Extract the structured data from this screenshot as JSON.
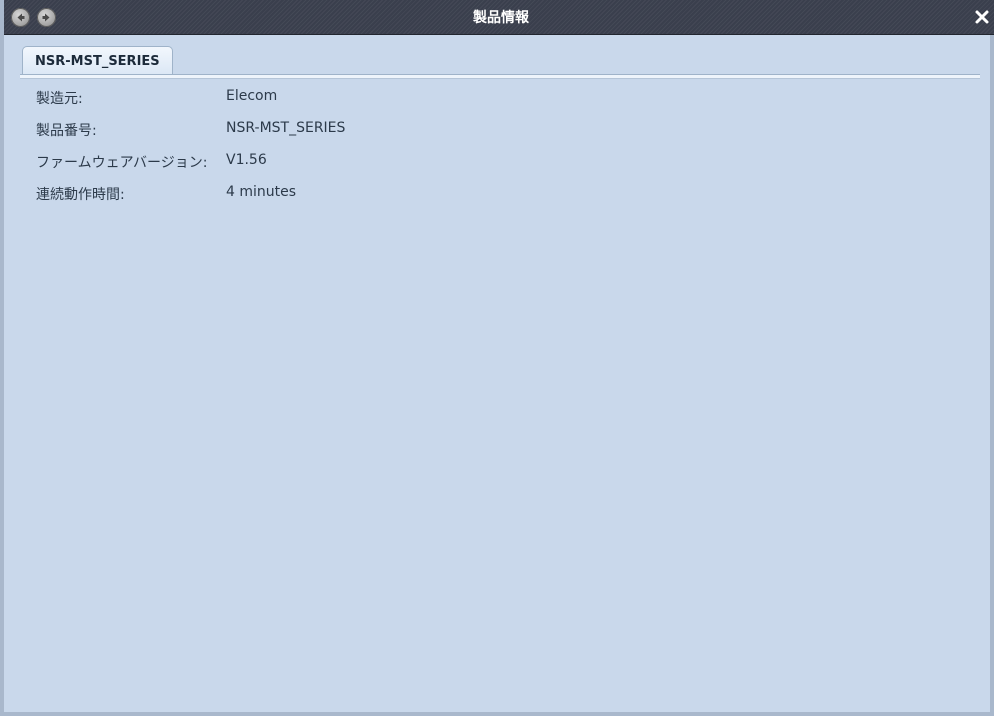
{
  "window": {
    "title": "製品情報"
  },
  "tabs": [
    {
      "label": "NSR-MST_SERIES",
      "active": true
    }
  ],
  "info": [
    {
      "label": "製造元:",
      "value": "Elecom"
    },
    {
      "label": "製品番号:",
      "value": "NSR-MST_SERIES"
    },
    {
      "label": "ファームウェアバージョン:",
      "value": "V1.56"
    },
    {
      "label": "連続動作時間:",
      "value": "4 minutes"
    }
  ],
  "icons": {
    "back": "arrow-left-icon",
    "forward": "arrow-right-icon",
    "close": "close-icon"
  },
  "colors": {
    "titlebar": "#3a3f4d",
    "content_bg": "#c9d8eb",
    "text": "#2c3a4a"
  }
}
